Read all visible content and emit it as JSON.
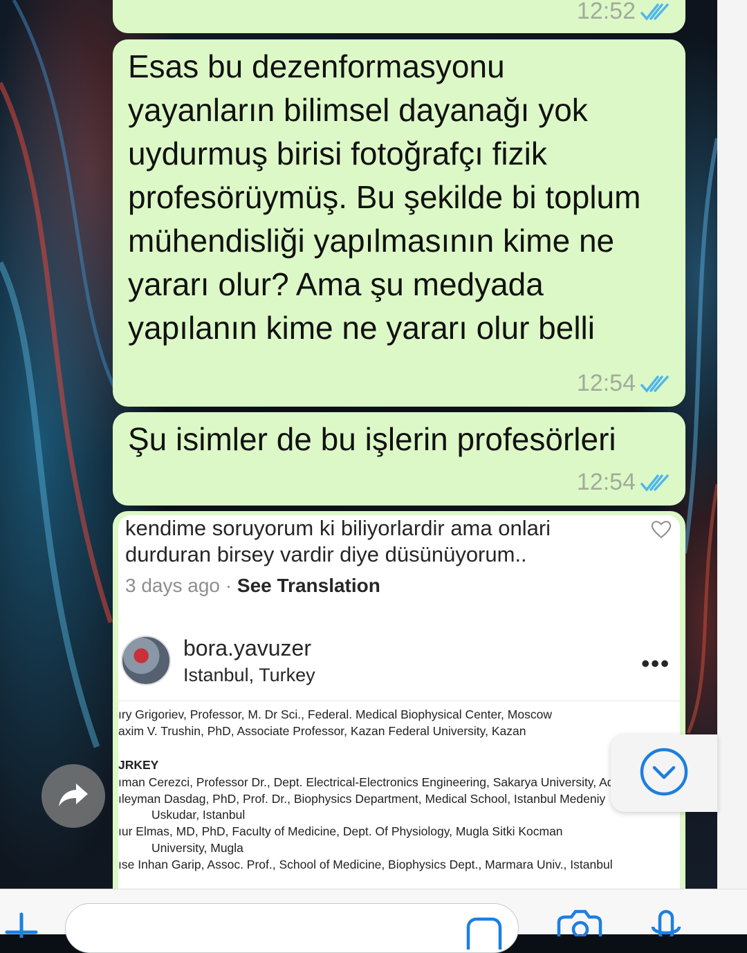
{
  "colors": {
    "bubble": "#dcf8c6",
    "tick": "#4fb6ec",
    "accent": "#1d7fe0"
  },
  "messages": [
    {
      "time": "12:52"
    },
    {
      "text": "Esas bu dezenformasyonu yayanların bilimsel dayanağı yok uydurmuş birisi fotoğrafçı fizik profesörüymüş. Bu şekilde bi toplum mühendisliği yapılmasının kime ne yararı olur? Ama şu medyada yapılanın kime ne yararı olur belli",
      "time": "12:54"
    },
    {
      "text": "Şu isimler de bu işlerin profesörleri",
      "time": "12:54"
    }
  ],
  "shared_post": {
    "comment": "kendime soruyorum ki biliyorlardir ama onlari durduran birsey vardir diye düsünüyorum..",
    "age": "3 days ago",
    "separator": "·",
    "see_translation": "See Translation",
    "username": "bora.yavuzer",
    "location": "Istanbul, Turkey",
    "more": "•••",
    "document_lines": [
      "ıry Grigoriev, Professor, M. Dr Sci., Federal. Medical Biophysical Center, Moscow",
      "axim V. Trushin, PhD, Associate Professor, Kazan Federal University, Kazan",
      "JRKEY",
      "ıman Cerezci, Professor Dr., Dept. Electrical-Electronics Engineering, Sakarya University, Ad",
      "ıleyman Dasdag,  PhD, Prof. Dr., Biophysics Department, Medical School, Istanbul Medeniy",
      "Uskudar, Istanbul",
      "ıur Elmas, MD, PhD, Faculty of Medicine, Dept. Of Physiology, Mugla Sitki Kocman",
      "University, Mugla",
      "ıse Inhan Garip, Assoc. Prof., School of Medicine, Biophysics Dept.,  Marmara Univ., Istanbul"
    ]
  },
  "icons": {
    "forward": "forward-arrow-icon",
    "scroll": "chevron-down-icon",
    "add": "plus-icon",
    "sticker": "sticker-icon",
    "camera": "camera-icon",
    "mic": "microphone-icon"
  }
}
